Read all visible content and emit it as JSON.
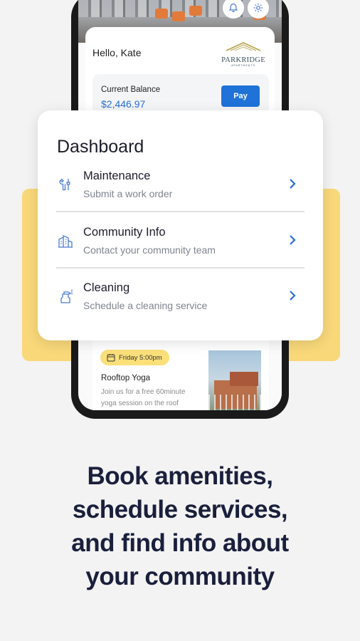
{
  "colors": {
    "background": "#f3f3f3",
    "accent_yellow": "#f9d87a",
    "primary_blue": "#1e72d8",
    "dark_navy": "#1a1f3c",
    "muted_text": "#7e8490"
  },
  "header": {
    "greeting": "Hello, Kate",
    "notification_icon": "bell-icon",
    "settings_icon": "gear-icon"
  },
  "logo": {
    "name": "PARKRIDGE",
    "subtitle": "APARTMENTS"
  },
  "balance": {
    "label": "Current Balance",
    "amount": "$2,446.97",
    "pay_label": "Pay"
  },
  "dashboard": {
    "title": "Dashboard",
    "items": [
      {
        "label": "Maintenance",
        "subtitle": "Submit a work order",
        "icon": "wrench-screwdriver-icon"
      },
      {
        "label": "Community Info",
        "subtitle": "Contact your community team",
        "icon": "buildings-icon"
      },
      {
        "label": "Cleaning",
        "subtitle": "Schedule a cleaning service",
        "icon": "spray-bottle-icon"
      }
    ]
  },
  "event": {
    "badge": "Friday 5:00pm",
    "title": "Rooftop Yoga",
    "description": "Join us for a free 60minute yoga session on the roof"
  },
  "tagline": [
    "Book amenities,",
    "schedule services,",
    "and find info about",
    "your community"
  ]
}
